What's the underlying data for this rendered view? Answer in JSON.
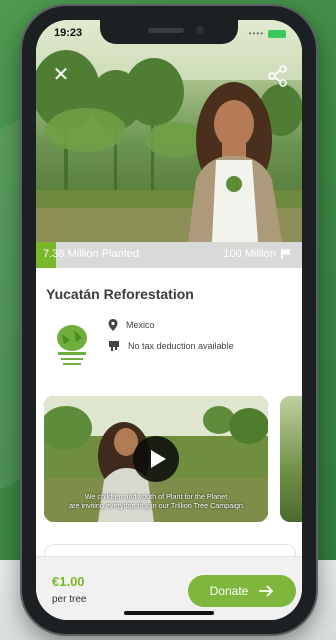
{
  "status_bar": {
    "time": "19:23"
  },
  "progress": {
    "planted_label": "7.38 Million Planted",
    "goal_label": "100 Million",
    "fraction": 0.0738
  },
  "project": {
    "title": "Yucatán Reforestation",
    "location": "Mexico",
    "tax_note": "No tax deduction available",
    "logo_text": "Plant for the Planet"
  },
  "video": {
    "caption_line1": "We children and youth of Plant for the Planet",
    "caption_line2": "are inviting everyone to join our Trillion Tree Campaign"
  },
  "footer": {
    "price": "€1.00",
    "price_unit": "per tree",
    "donate_label": "Donate"
  },
  "colors": {
    "accent": "#78b82a",
    "button": "#7eb73b",
    "progress_track": "#d8dad8"
  },
  "icons": [
    "close-icon",
    "share-icon",
    "flag-icon",
    "location-pin-icon",
    "receipt-icon",
    "play-icon",
    "arrow-right-icon"
  ]
}
